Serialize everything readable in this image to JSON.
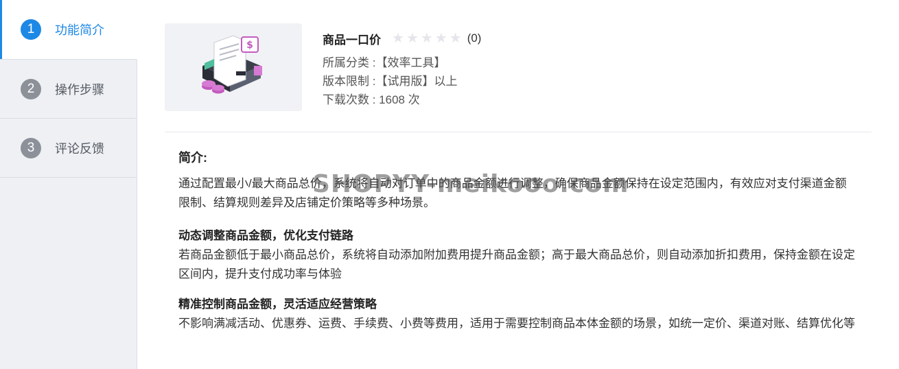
{
  "sidebar": {
    "steps": [
      {
        "num": "1",
        "label": "功能简介",
        "active": true
      },
      {
        "num": "2",
        "label": "操作步骤",
        "active": false
      },
      {
        "num": "3",
        "label": "评论反馈",
        "active": false
      }
    ]
  },
  "product": {
    "title": "商品一口价",
    "rating_stars": 0,
    "max_stars": 5,
    "rating_count": "(0)",
    "category": "所属分类 :【效率工具】",
    "version_limit": "版本限制 :【试用版】以上",
    "downloads": "下载次数 : 1608 次"
  },
  "content": {
    "intro_heading": "简介:",
    "intro_text": "通过配置最小/最大商品总价，系统将自动对订单中的商品金额进行调整，确保商品金额保持在设定范围内，有效应对支付渠道金额限制、结算规则差异及店铺定价策略等多种场景。",
    "sections": [
      {
        "heading": "动态调整商品金额，优化支付链路",
        "text": "若商品金额低于最小商品总价，系统将自动添加附加费用提升商品金额；高于最大商品总价，则自动添加折扣费用，保持金额在设定区间内，提升支付成功率与体验"
      },
      {
        "heading": "精准控制商品金额，灵活适应经营策略",
        "text": "不影响满减活动、优惠券、运费、手续费、小费等费用，适用于需要控制商品本体金额的场景，如统一定价、渠道对账、结算优化等"
      }
    ]
  },
  "watermark": "SHOPYY-meikooo.com",
  "colors": {
    "accent": "#1e88e5",
    "inactive_num": "#8c9099",
    "sidebar_bg": "#eef0f3"
  }
}
